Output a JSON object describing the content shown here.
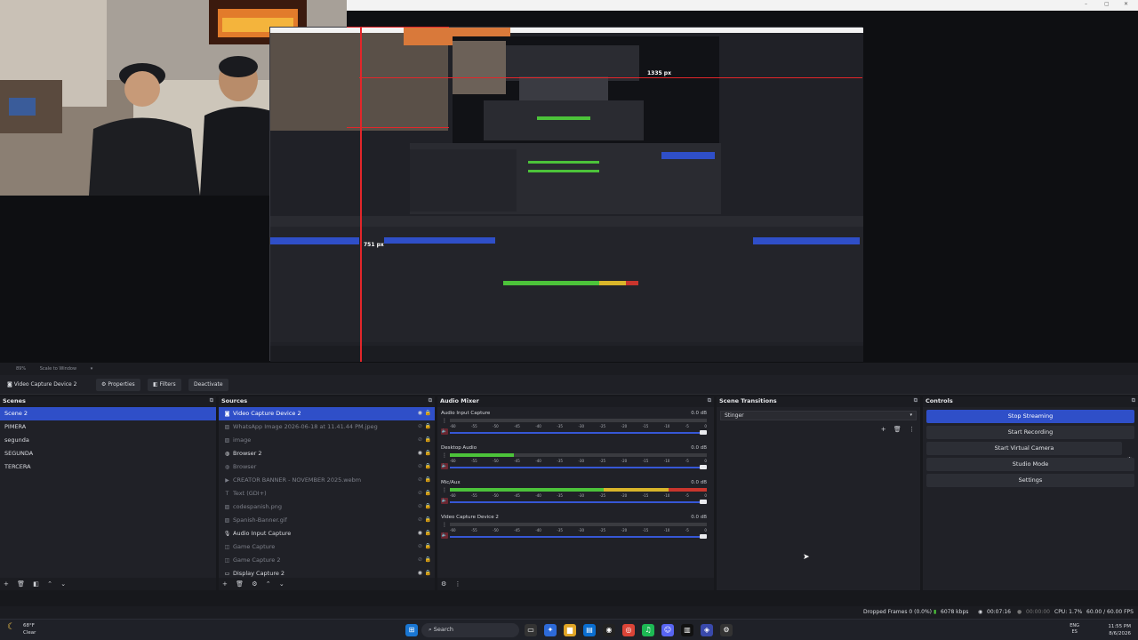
{
  "preview": {
    "px_label_1": "1335 px",
    "px_label_2": "751 px",
    "zoom_text": "89%",
    "scale_mode": "Scale to Window"
  },
  "source_toolbar": {
    "selected_source": "Video Capture Device 2",
    "properties_label": "Properties",
    "filters_label": "Filters",
    "deactivate_label": "Deactivate"
  },
  "scenes": {
    "title": "Scenes",
    "items": [
      "Scene 2",
      "PIMERA",
      "segunda",
      "SEGUNDA",
      "TERCERA"
    ]
  },
  "sources": {
    "title": "Sources",
    "items": [
      {
        "label": "Video Capture Device 2",
        "icon": "camera-icon"
      },
      {
        "label": "WhatsApp Image 2026-06-18 at 11.41.44 PM.jpeg",
        "icon": "image-icon"
      },
      {
        "label": "image",
        "icon": "image-icon"
      },
      {
        "label": "Browser 2",
        "icon": "globe-icon"
      },
      {
        "label": "Browser",
        "icon": "globe-icon"
      },
      {
        "label": "CREATOR BANNER - NOVEMBER 2025.webm",
        "icon": "play-icon"
      },
      {
        "label": "Text (GDI+)",
        "icon": "text-icon"
      },
      {
        "label": "codespanish.png",
        "icon": "image-icon"
      },
      {
        "label": "Spanish-Banner.gif",
        "icon": "image-icon"
      },
      {
        "label": "Audio Input Capture",
        "icon": "mic-icon"
      },
      {
        "label": "Game Capture",
        "icon": "gamepad-icon"
      },
      {
        "label": "Game Capture 2",
        "icon": "gamepad-icon"
      },
      {
        "label": "Display Capture 2",
        "icon": "monitor-icon"
      }
    ]
  },
  "mixer": {
    "title": "Audio Mixer",
    "channels": [
      {
        "name": "Audio Input Capture",
        "db": "0.0 dB",
        "level": 0.0
      },
      {
        "name": "Desktop Audio",
        "db": "0.0 dB",
        "level": 0.25
      },
      {
        "name": "Mic/Aux",
        "db": "0.0 dB",
        "level": 1.0
      },
      {
        "name": "Video Capture Device 2",
        "db": "0.0 dB",
        "level": 0.0
      }
    ],
    "ticks": [
      "-60",
      "-55",
      "-50",
      "-45",
      "-40",
      "-35",
      "-30",
      "-25",
      "-20",
      "-15",
      "-10",
      "-5",
      "0"
    ]
  },
  "transitions": {
    "title": "Scene Transitions",
    "selected": "Stinger"
  },
  "controls": {
    "title": "Controls",
    "stop_streaming": "Stop Streaming",
    "start_recording": "Start Recording",
    "start_virtual_camera": "Start Virtual Camera",
    "studio_mode": "Studio Mode",
    "settings": "Settings"
  },
  "status": {
    "dropped_frames": "Dropped Frames 0 (0.0%)",
    "bitrate": "6078 kbps",
    "stream_time": "00:07:16",
    "record_time": "00:00:00",
    "cpu": "CPU: 1.7%",
    "fps": "60.00 / 60.00 FPS"
  },
  "taskbar": {
    "weather_temp": "68°F",
    "weather_desc": "Clear",
    "search_placeholder": "Search",
    "lang_1": "ENG",
    "lang_2": "ES",
    "time": "11:55 PM",
    "date": "8/6/2026"
  },
  "colors": {
    "accent": "#2f4fc8",
    "meter_green": "#4cc33a",
    "meter_yellow": "#d9b52a",
    "meter_red": "#c9352d",
    "guide_red": "#e3262a"
  }
}
